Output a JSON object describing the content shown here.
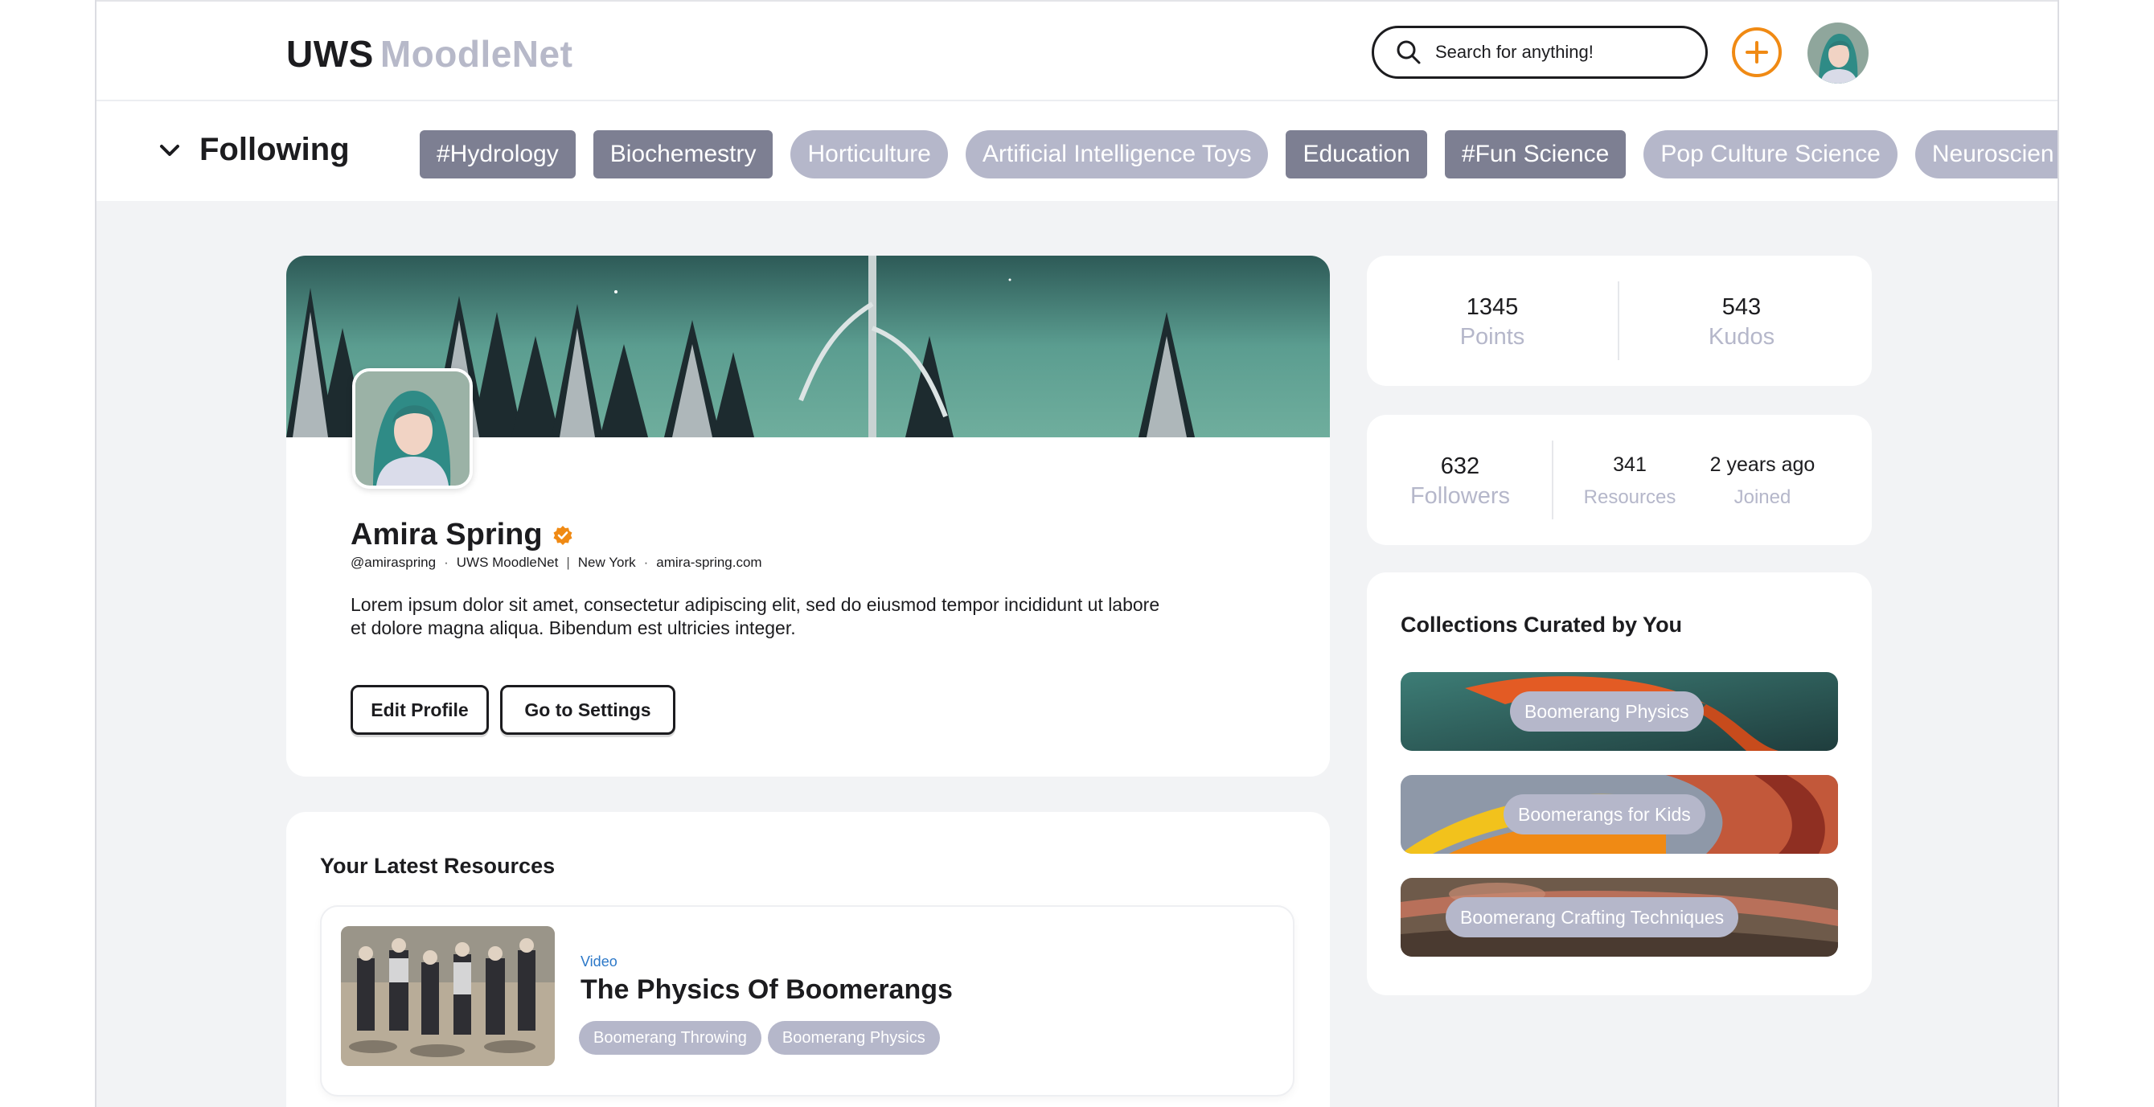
{
  "header": {
    "brand": "UWS",
    "product": "MoodleNet",
    "search_placeholder": "Search for anything!",
    "icons": [
      "search-icon",
      "add-icon",
      "avatar"
    ]
  },
  "following": {
    "label": "Following",
    "chips": [
      {
        "label": "#Hydrology",
        "style": "dark"
      },
      {
        "label": "Biochemestry",
        "style": "dark"
      },
      {
        "label": "Horticulture",
        "style": "light"
      },
      {
        "label": "Artificial Intelligence Toys",
        "style": "light"
      },
      {
        "label": "Education",
        "style": "dark"
      },
      {
        "label": "#Fun Science",
        "style": "dark"
      },
      {
        "label": "Pop Culture Science",
        "style": "light"
      },
      {
        "label": "Neuroscien",
        "style": "light"
      }
    ]
  },
  "profile": {
    "name": "Amira Spring",
    "handle": "@amiraspring",
    "dot1": "·",
    "org": "UWS MoodleNet",
    "pipe": "|",
    "location": "New York",
    "dot2": "·",
    "website": "amira-spring.com",
    "bio": "Lorem ipsum dolor sit amet, consectetur adipiscing elit, sed do eiusmod tempor incididunt ut labore et dolore magna aliqua. Bibendum est ultricies integer.",
    "edit_label": "Edit Profile",
    "settings_label": "Go to Settings"
  },
  "stats": {
    "points": {
      "value": "1345",
      "label": "Points"
    },
    "kudos": {
      "value": "543",
      "label": "Kudos"
    },
    "followers": {
      "value": "632",
      "label": "Followers"
    },
    "resources": {
      "value": "341",
      "label": "Resources"
    },
    "joined": {
      "value": "2 years ago",
      "label": "Joined"
    }
  },
  "collections": {
    "title": "Collections Curated by You",
    "items": [
      {
        "label": "Boomerang Physics"
      },
      {
        "label": "Boomerangs for Kids"
      },
      {
        "label": "Boomerang Crafting Techniques"
      }
    ]
  },
  "resources": {
    "title": "Your Latest Resources",
    "items": [
      {
        "type": "Video",
        "title": "The Physics Of Boomerangs",
        "tags": [
          "Boomerang Throwing",
          "Boomerang Physics"
        ]
      }
    ]
  },
  "colors": {
    "accent": "#f08a14",
    "chip_dark": "#7d7f92",
    "chip_light": "#b5b7ca",
    "link_blue": "#2c78c8",
    "background": "#f2f3f5"
  }
}
